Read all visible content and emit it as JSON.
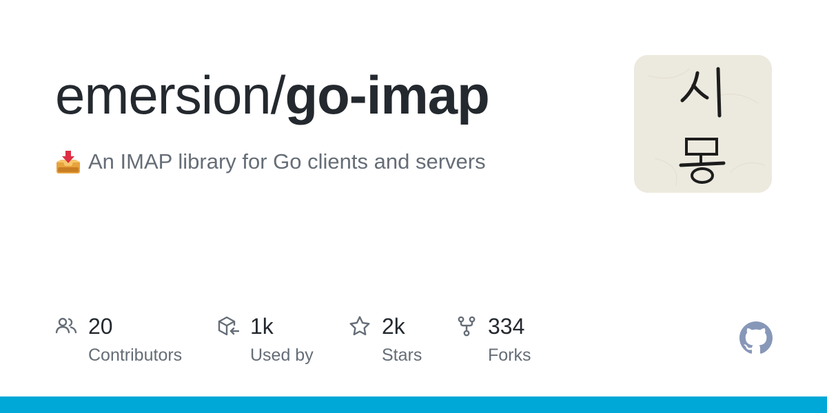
{
  "repo": {
    "owner": "emersion/",
    "name": "go-imap"
  },
  "description": {
    "emoji": "inbox-tray-icon",
    "text": "An IMAP library for Go clients and servers"
  },
  "avatar": {
    "alt": "시몽"
  },
  "stats": [
    {
      "icon": "people-icon",
      "value": "20",
      "label": "Contributors"
    },
    {
      "icon": "package-dependents-icon",
      "value": "1k",
      "label": "Used by"
    },
    {
      "icon": "star-icon",
      "value": "2k",
      "label": "Stars"
    },
    {
      "icon": "repo-forked-icon",
      "value": "334",
      "label": "Forks"
    }
  ],
  "colors": {
    "bottom_bar": "#00a8d8",
    "icon_gray": "#656d76",
    "github_mark": "#8797b8"
  }
}
